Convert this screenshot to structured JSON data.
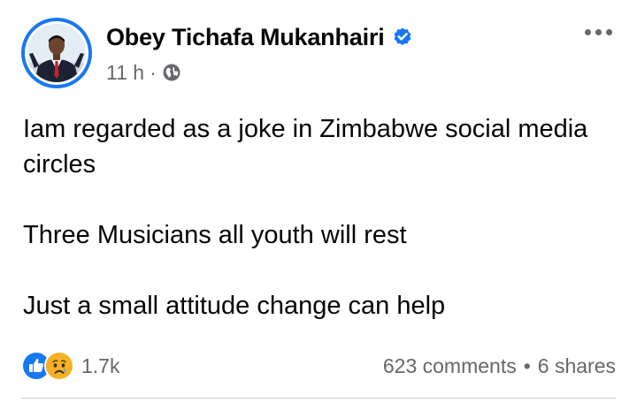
{
  "post": {
    "author": {
      "name": "Obey Tichafa Mukanhairi",
      "verified": true,
      "avatar": "profile-photo"
    },
    "meta": {
      "time": "11 h",
      "separator": "·",
      "audience_icon": "globe-icon"
    },
    "more_icon": "more-options-icon",
    "body": {
      "paragraphs": [
        "Iam regarded as a joke in Zimbabwe social media circles",
        "Three Musicians all youth will rest",
        "Just a small attitude change can help"
      ]
    },
    "stats": {
      "reaction_icons": [
        "like-icon",
        "sad-icon"
      ],
      "reaction_count": "1.7k",
      "comments": "623 comments",
      "separator": "•",
      "shares": "6 shares"
    }
  },
  "colors": {
    "accent": "#1877f2",
    "text": "#050505",
    "secondary_text": "#65676b",
    "sad_yellow": "#f7b125"
  }
}
